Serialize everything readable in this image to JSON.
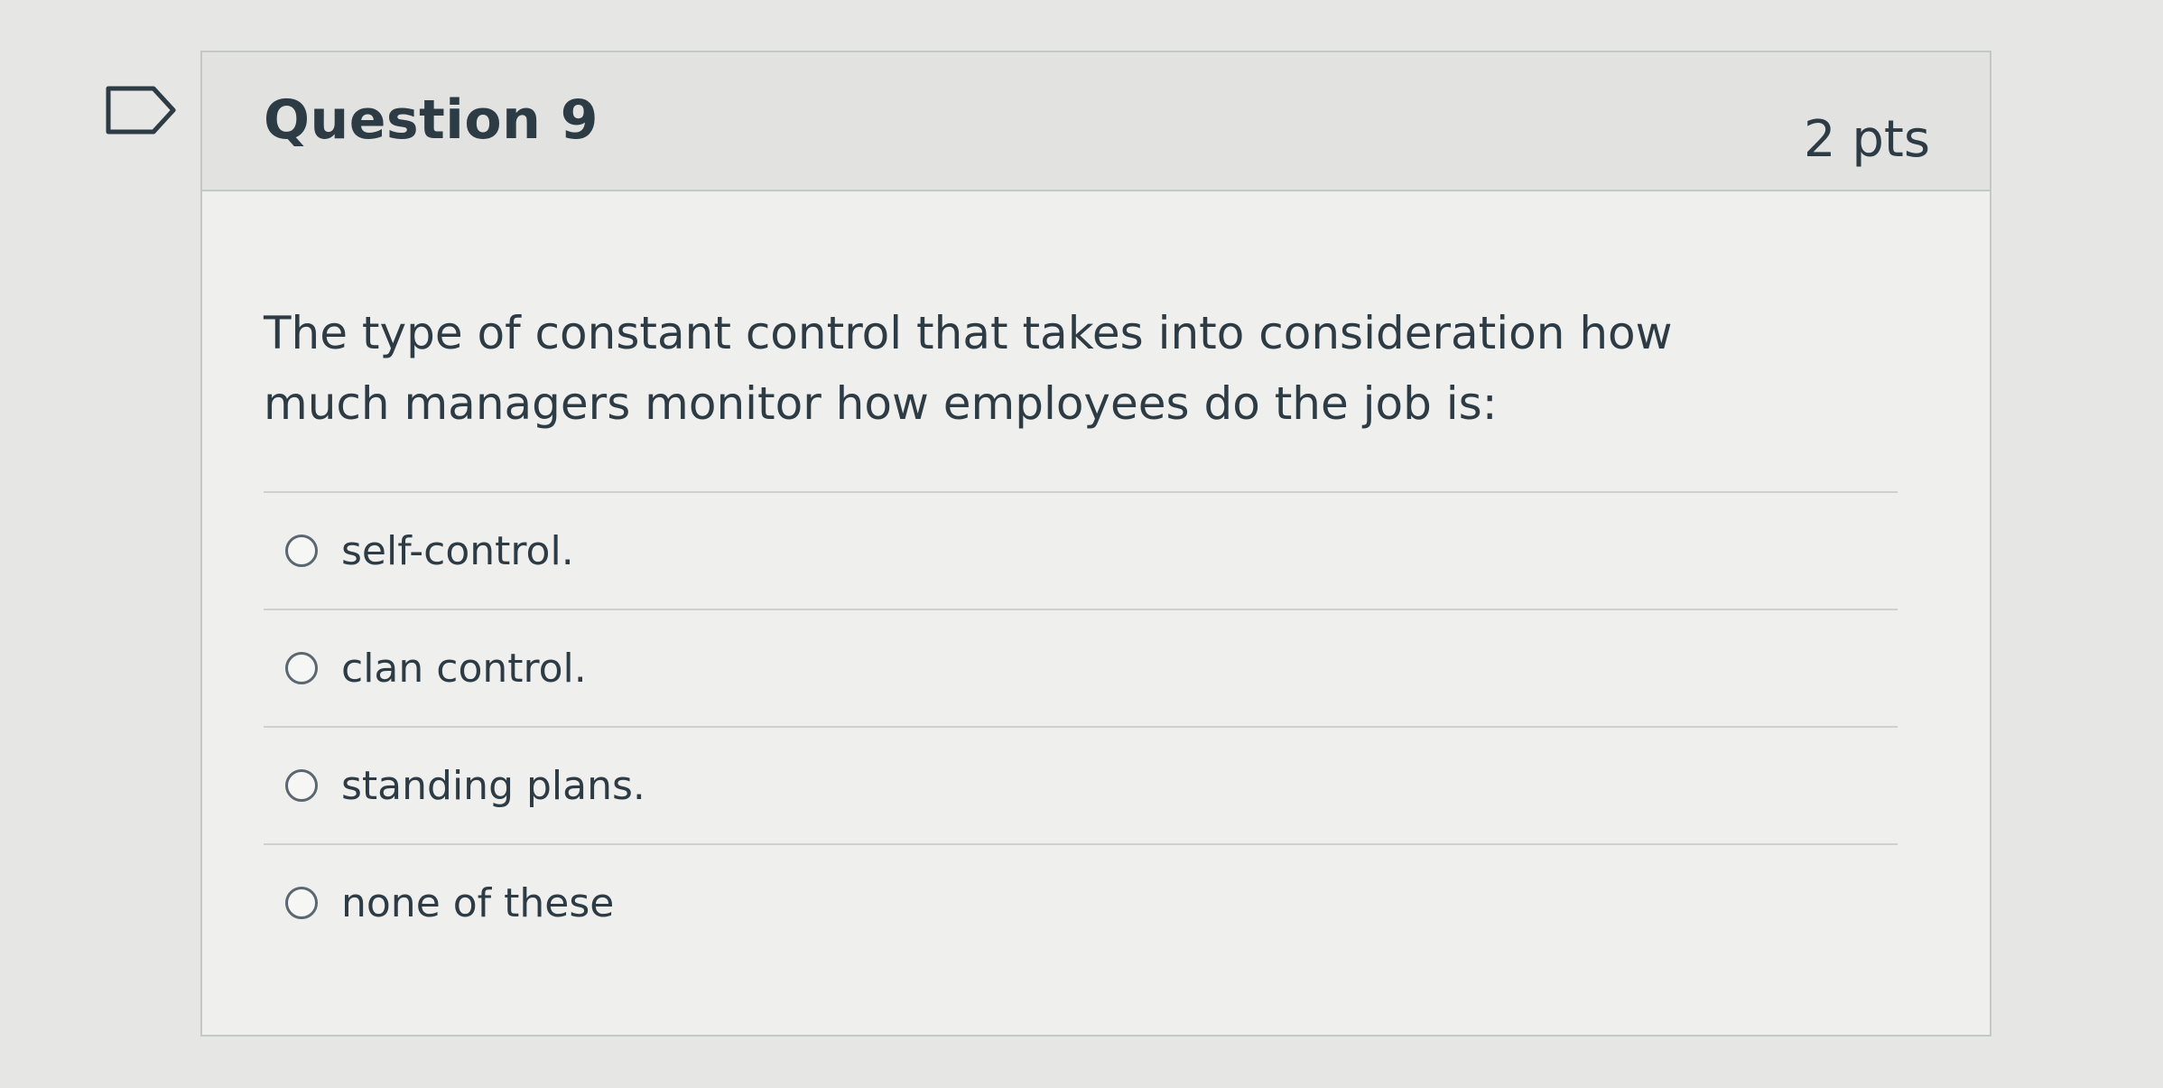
{
  "question": {
    "title": "Question 9",
    "points": "2 pts",
    "text": "The type of constant control that takes into consideration how much managers monitor how employees do the job is:",
    "flag_icon": "flag-question-icon",
    "answers": [
      {
        "label": "self-control."
      },
      {
        "label": "clan control."
      },
      {
        "label": "standing plans."
      },
      {
        "label": "none of these"
      }
    ]
  },
  "colors": {
    "text": "#2d3b45",
    "header_bg": "#e2e3e1",
    "border": "#c4c7c8"
  }
}
